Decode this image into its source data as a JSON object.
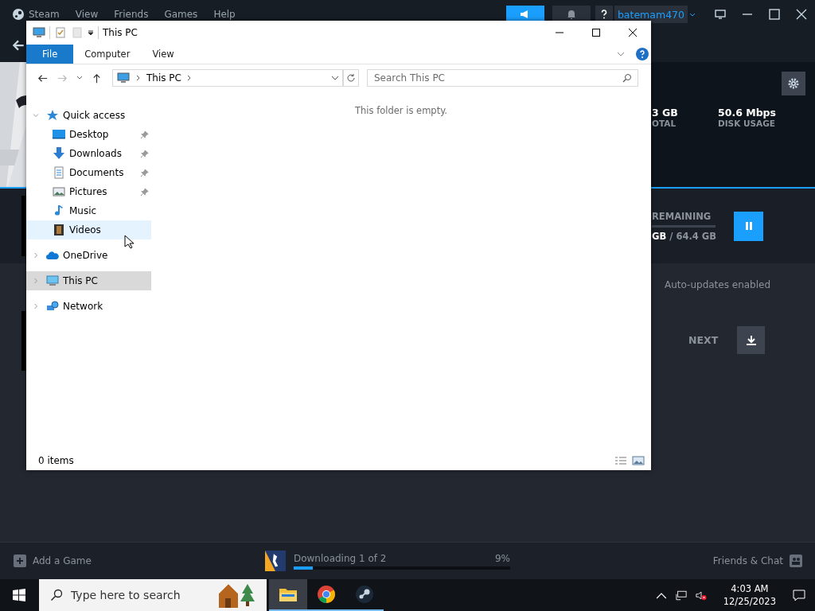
{
  "steam": {
    "menu": [
      "Steam",
      "View",
      "Friends",
      "Games",
      "Help"
    ],
    "user": "batemam470",
    "stats": [
      {
        "value": "3 GB",
        "label": "OTAL"
      },
      {
        "value": "50.6 Mbps",
        "label": "DISK USAGE"
      }
    ],
    "current": {
      "remaining_label": "REMAINING",
      "downloaded": "GB",
      "total": "/ 64.4 GB"
    },
    "up_next": {
      "auto_updates": "Auto-updates enabled",
      "next_label": "NEXT"
    },
    "bottom_bar": {
      "add_game": "Add a Game",
      "status": "Downloading 1 of 2",
      "percent": "9%",
      "level": 0.09,
      "friends": "Friends & Chat"
    }
  },
  "explorer": {
    "title": "This PC",
    "tabs": [
      {
        "label": "File",
        "selected": true
      },
      {
        "label": "Computer",
        "selected": false
      },
      {
        "label": "View",
        "selected": false
      }
    ],
    "address": "This PC",
    "search": {
      "placeholder": "Search This PC"
    },
    "nav": [
      {
        "label": "Quick access",
        "kind": "star",
        "selected": false,
        "expanded": true,
        "children": [
          {
            "label": "Desktop",
            "kind": "desktop",
            "pinned": true,
            "hovered": false
          },
          {
            "label": "Downloads",
            "kind": "download",
            "pinned": true,
            "hovered": false
          },
          {
            "label": "Documents",
            "kind": "document",
            "pinned": true,
            "hovered": false
          },
          {
            "label": "Pictures",
            "kind": "pictures",
            "pinned": true,
            "hovered": false
          },
          {
            "label": "Music",
            "kind": "music",
            "pinned": false,
            "hovered": false
          },
          {
            "label": "Videos",
            "kind": "video",
            "pinned": false,
            "hovered": true
          }
        ]
      },
      {
        "label": "OneDrive",
        "kind": "cloud",
        "selected": false,
        "expanded": false
      },
      {
        "label": "This PC",
        "kind": "pc",
        "selected": true,
        "expanded": false
      },
      {
        "label": "Network",
        "kind": "network",
        "selected": false,
        "expanded": false
      }
    ],
    "empty_message": "This folder is empty.",
    "status": "0 items"
  },
  "taskbar": {
    "search": {
      "placeholder": "Type here to search"
    },
    "apps": [
      {
        "kind": "folder",
        "selected": true
      },
      {
        "kind": "chrome",
        "selected": false
      },
      {
        "kind": "steam",
        "selected": false
      }
    ],
    "time": "4:03 AM",
    "date": "12/25/2023"
  }
}
